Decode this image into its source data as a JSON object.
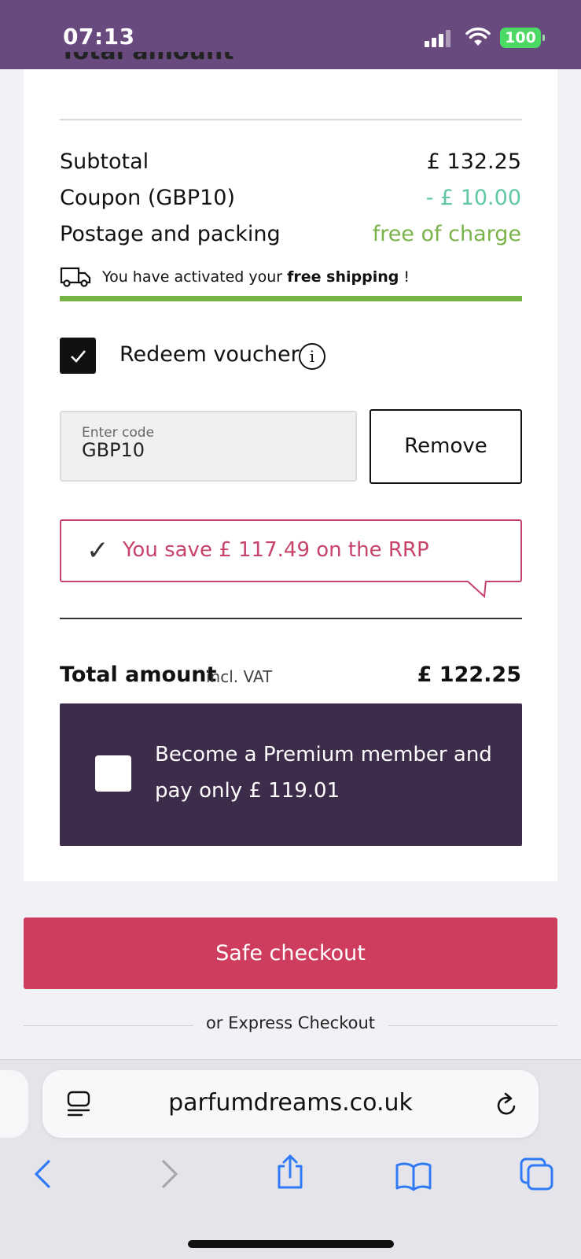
{
  "status_bar": {
    "time": "07:13",
    "battery": "100"
  },
  "order_summary": {
    "section_title_partial": "Total amount",
    "subtotal_label": "Subtotal",
    "subtotal_value": "£ 132.25",
    "coupon_label": "Coupon (GBP10)",
    "coupon_value": "- £ 10.00",
    "postage_label": "Postage and packing",
    "postage_value": "free of charge",
    "shipping_note_prefix": "You have activated your",
    "shipping_note_bold": "free shipping",
    "shipping_note_suffix": "!",
    "free_shipping_progress": 1.0
  },
  "voucher": {
    "checked": true,
    "label": "Redeem voucher",
    "info_glyph": "i",
    "code_placeholder": "Enter code",
    "code_value": "GBP10",
    "remove_label": "Remove"
  },
  "savings": {
    "text": "You save £ 117.49 on the RRP"
  },
  "total": {
    "label": "Total amount",
    "vat_note": "incl. VAT",
    "value": "£ 122.25"
  },
  "premium": {
    "text": "Become a Premium member and pay only £ 119.01",
    "checked": false
  },
  "checkout": {
    "button_label": "Safe checkout",
    "express_label": "or Express Checkout"
  },
  "browser": {
    "url": "parfumdreams.co.uk"
  },
  "colors": {
    "brand_purple": "#684a7f",
    "premium_bg": "#3e2c4b",
    "checkout_red": "#cf3d5e",
    "success_green": "#78b346",
    "save_pink": "#c8436a"
  }
}
